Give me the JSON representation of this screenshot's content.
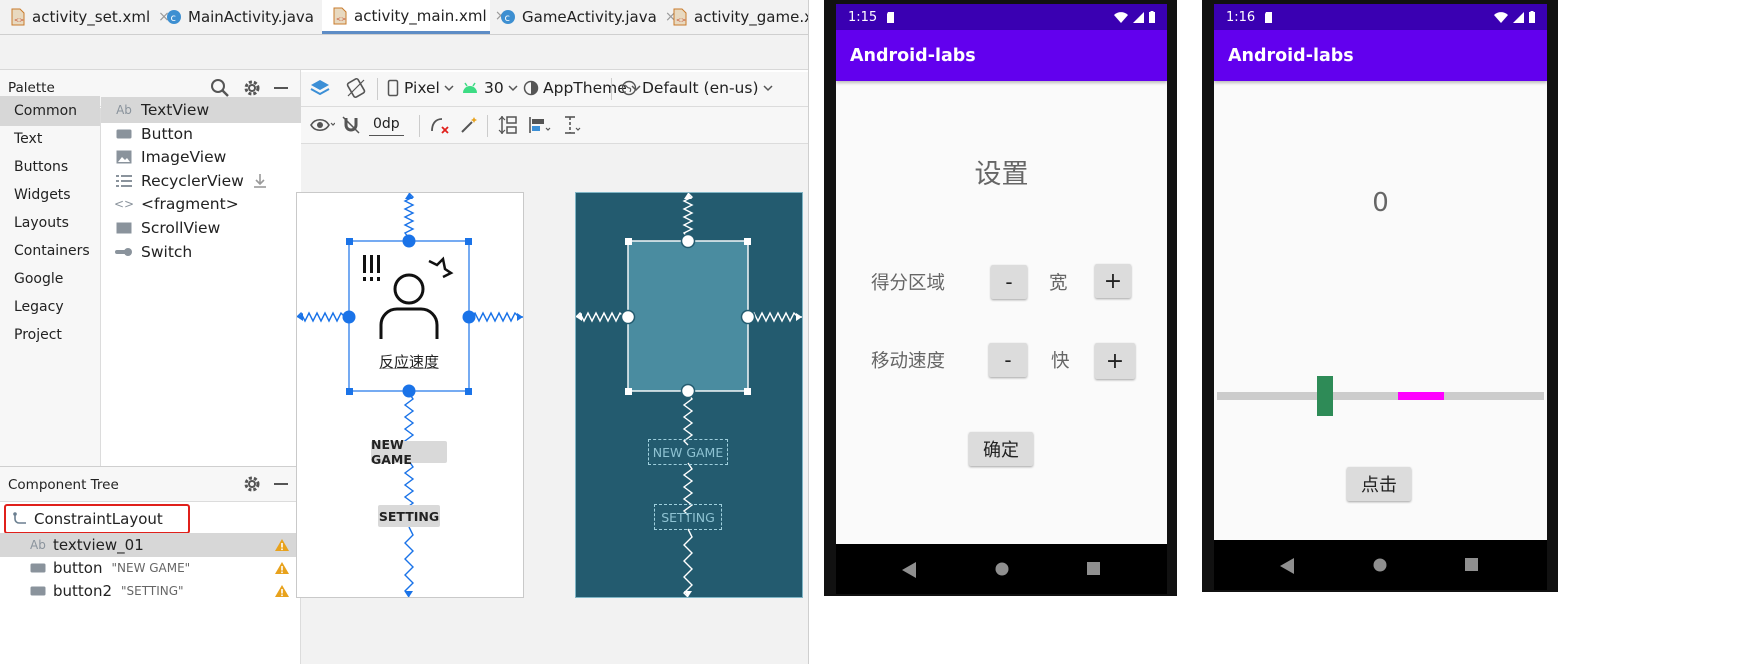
{
  "ide": {
    "tabs": [
      {
        "label": "activity_set.xml",
        "kind": "xml",
        "close": "×"
      },
      {
        "label": "MainActivity.java",
        "kind": "java",
        "close": "×"
      },
      {
        "label": "activity_main.xml",
        "kind": "xml",
        "close": "×"
      },
      {
        "label": "GameActivity.java",
        "kind": "java",
        "close": "×"
      },
      {
        "label": "activity_game.xm",
        "kind": "xml"
      }
    ],
    "palette": {
      "title": "Palette",
      "categories": [
        "Common",
        "Text",
        "Buttons",
        "Widgets",
        "Layouts",
        "Containers",
        "Google",
        "Legacy",
        "Project"
      ],
      "selected_category": "Common",
      "items": [
        {
          "label": "TextView",
          "icon": "textview-icon",
          "glyph": "Ab"
        },
        {
          "label": "Button",
          "icon": "button-widget-icon"
        },
        {
          "label": "ImageView",
          "icon": "imageview-icon"
        },
        {
          "label": "RecyclerView",
          "icon": "recyclerview-icon"
        },
        {
          "label": "<fragment>",
          "icon": "fragment-icon",
          "glyph": "<>"
        },
        {
          "label": "ScrollView",
          "icon": "scrollview-icon"
        },
        {
          "label": "Switch",
          "icon": "switch-icon"
        }
      ],
      "selected_item": "TextView"
    },
    "toolbar": {
      "device": "Pixel",
      "api": "30",
      "theme": "AppTheme",
      "locale": "Default (en-us)",
      "margin": "0dp"
    },
    "component_tree": {
      "title": "Component Tree",
      "root": "ConstraintLayout",
      "children": [
        {
          "id": "textview_01",
          "glyph": "Ab",
          "text": "",
          "warning": true
        },
        {
          "id": "button",
          "text": "\"NEW GAME\"",
          "warning": true
        },
        {
          "id": "button2",
          "text": "\"SETTING\"",
          "warning": true
        }
      ]
    },
    "design": {
      "image_caption": "反应速度",
      "buttons": [
        "NEW GAME",
        "SETTING"
      ]
    }
  },
  "phone_settings": {
    "time": "1:15",
    "app_title": "Android-labs",
    "heading": "设置",
    "rows": [
      {
        "label": "得分区域",
        "minus": "-",
        "value": "宽",
        "plus": "+"
      },
      {
        "label": "移动速度",
        "minus": "-",
        "value": "快",
        "plus": "+"
      }
    ],
    "confirm": "确定"
  },
  "phone_game": {
    "time": "1:16",
    "app_title": "Android-labs",
    "score": "0",
    "button": "点击",
    "colors": {
      "paddle": "#2e8b57",
      "target": "#ff00ff",
      "track": "#cccccc"
    }
  },
  "colors": {
    "app_bar": "#6200ee",
    "status_bar": "#3a00b2",
    "blueprint": "#235b6f",
    "selection": "#1a73e8"
  }
}
